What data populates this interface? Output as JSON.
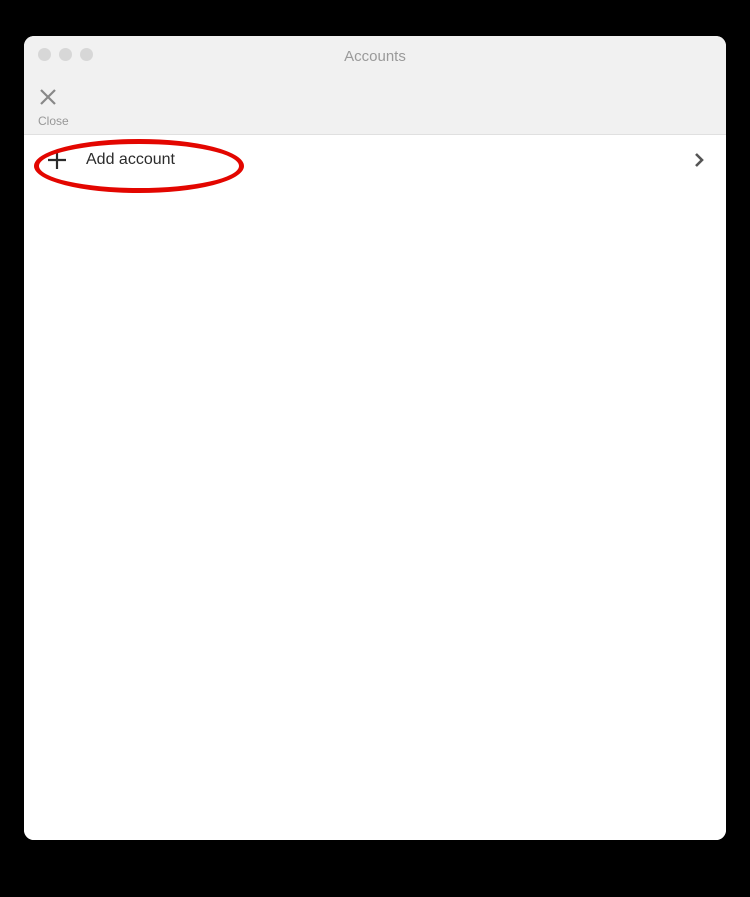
{
  "window": {
    "title": "Accounts"
  },
  "toolbar": {
    "close_label": "Close"
  },
  "rows": {
    "add_account": {
      "label": "Add account"
    }
  }
}
